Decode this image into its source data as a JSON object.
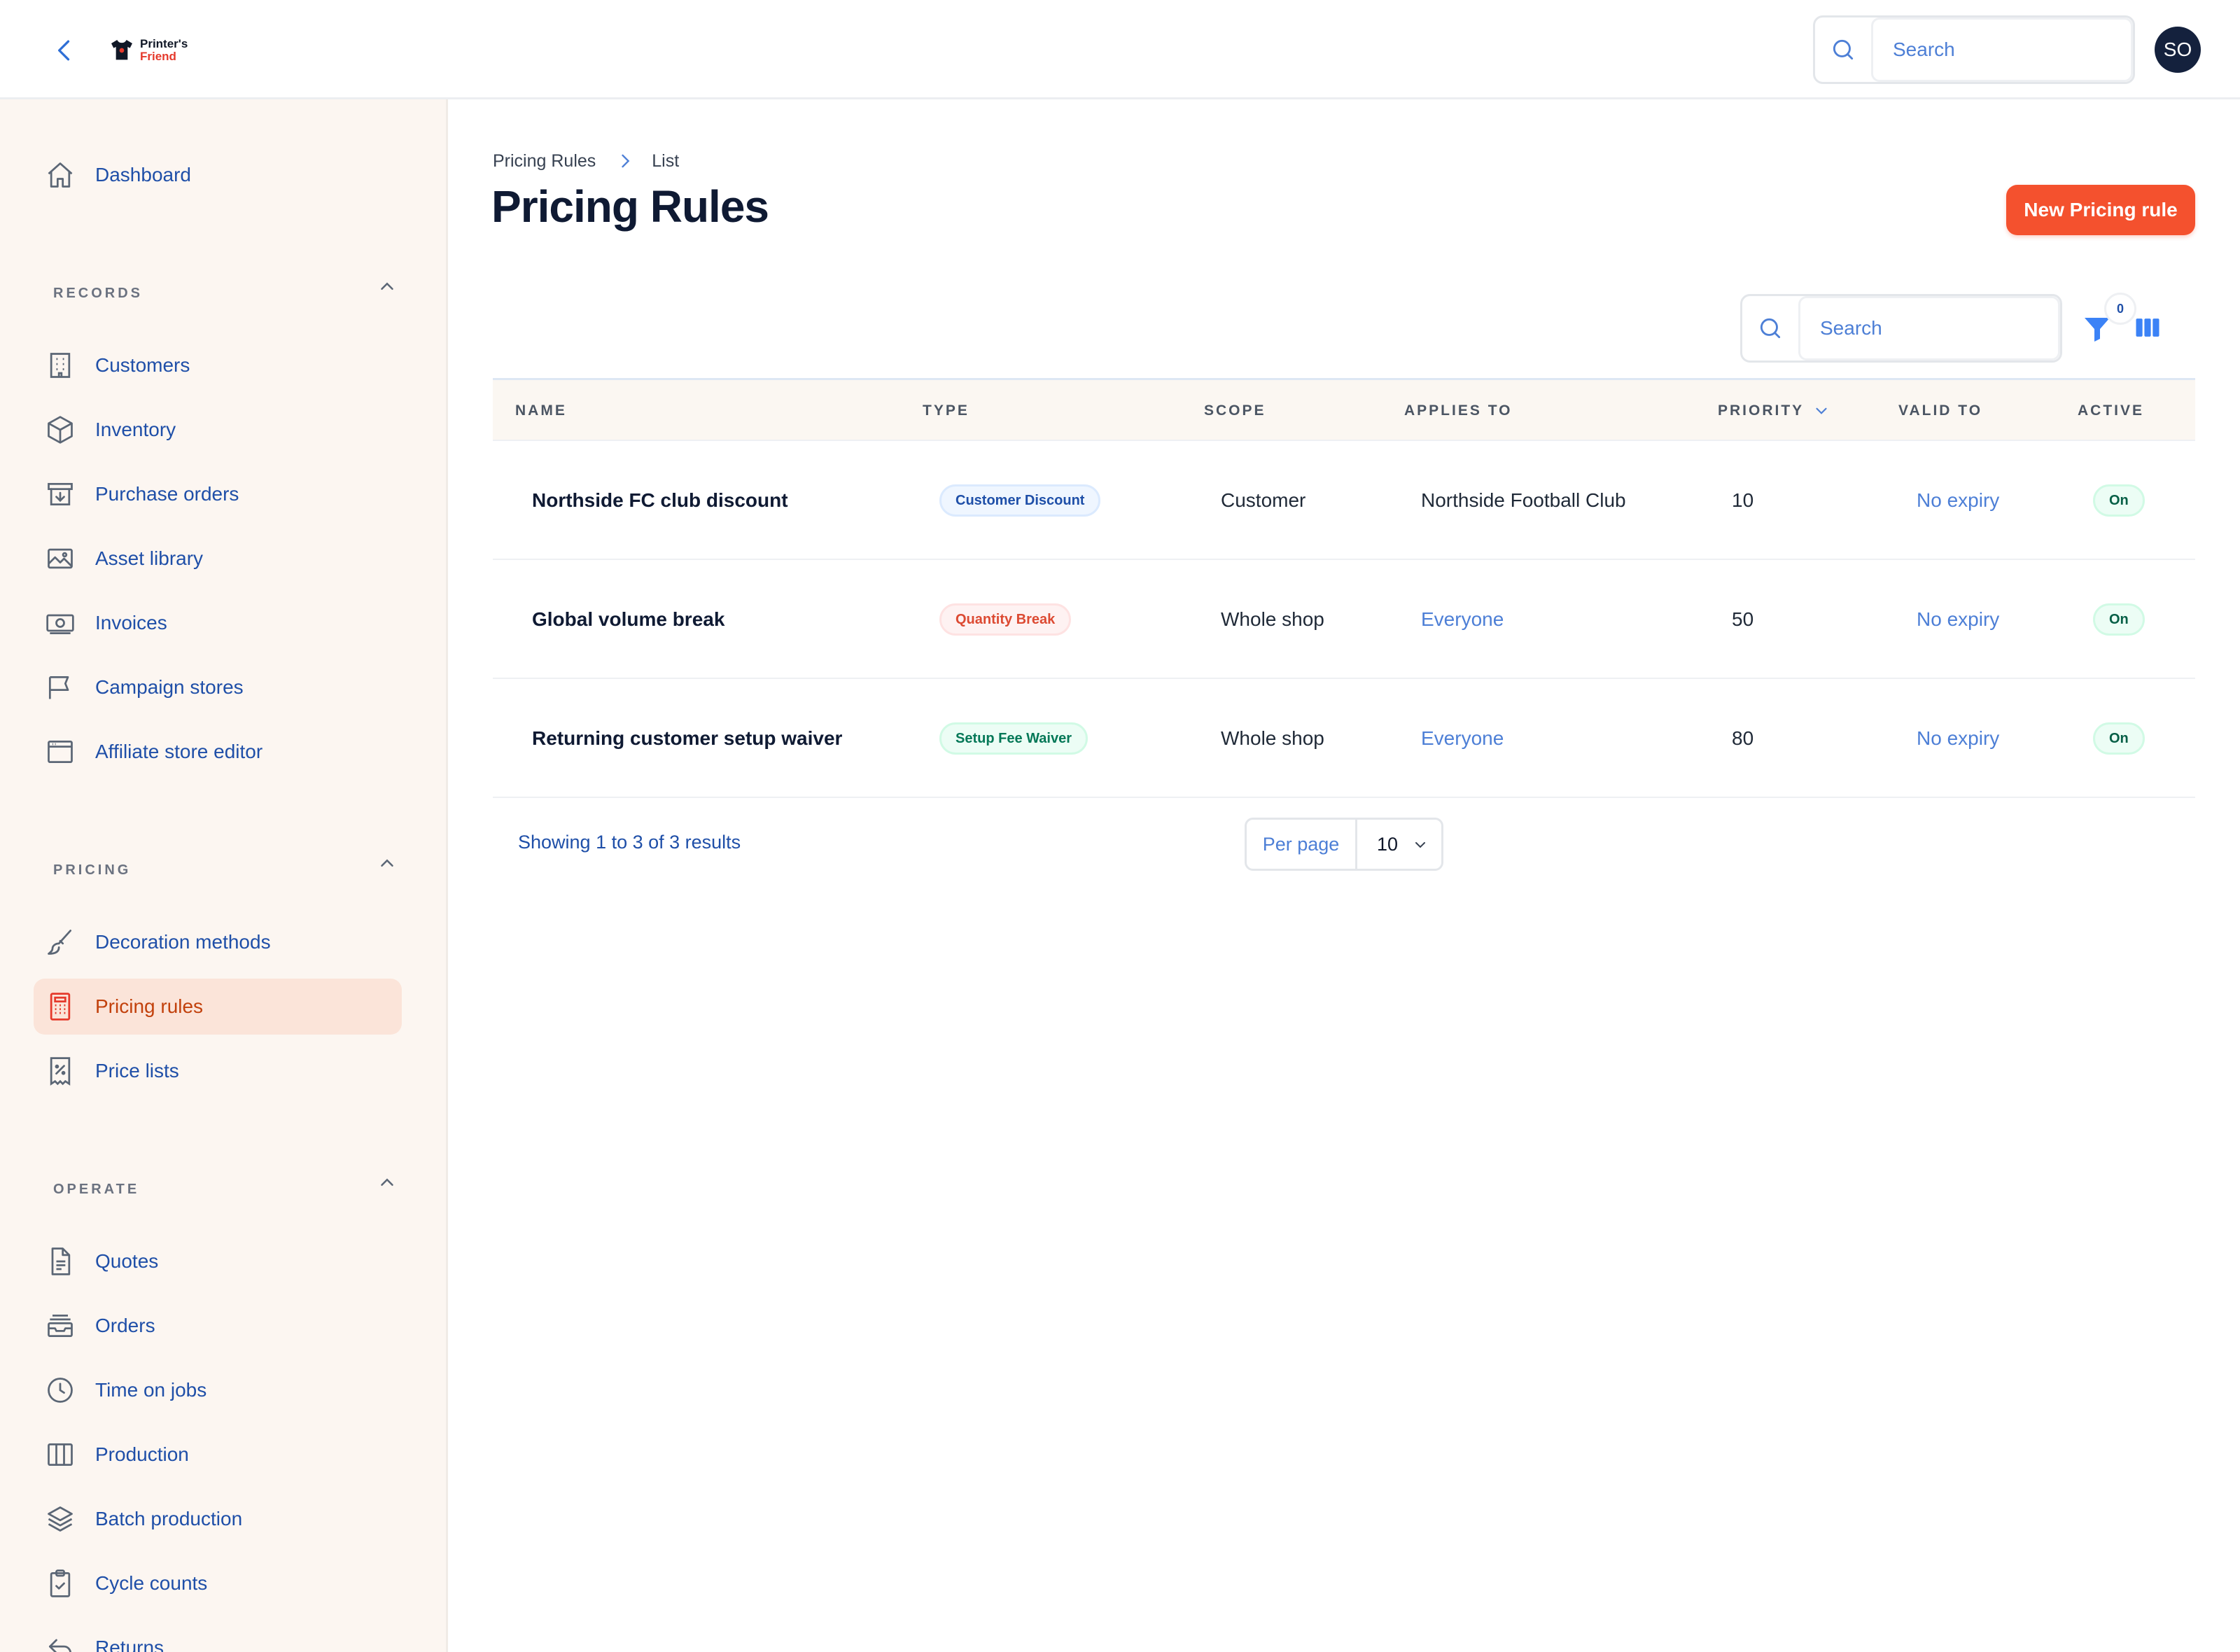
{
  "app": {
    "logo_line1": "Printer's",
    "logo_line2": "Friend",
    "search_placeholder": "Search",
    "avatar_initials": "SO"
  },
  "sidebar": {
    "dashboard": {
      "label": "Dashboard",
      "icon": "home-icon"
    },
    "sections": [
      {
        "title": "RECORDS",
        "items": [
          {
            "label": "Customers",
            "icon": "building-icon"
          },
          {
            "label": "Inventory",
            "icon": "box-icon"
          },
          {
            "label": "Purchase orders",
            "icon": "archive-download-icon"
          },
          {
            "label": "Asset library",
            "icon": "image-icon"
          },
          {
            "label": "Invoices",
            "icon": "cash-icon"
          },
          {
            "label": "Campaign stores",
            "icon": "flag-icon"
          },
          {
            "label": "Affiliate store editor",
            "icon": "browser-window-icon"
          }
        ]
      },
      {
        "title": "PRICING",
        "items": [
          {
            "label": "Decoration methods",
            "icon": "paintbrush-icon"
          },
          {
            "label": "Pricing rules",
            "icon": "calculator-icon",
            "active": true
          },
          {
            "label": "Price lists",
            "icon": "receipt-percent-icon"
          }
        ]
      },
      {
        "title": "OPERATE",
        "items": [
          {
            "label": "Quotes",
            "icon": "document-icon"
          },
          {
            "label": "Orders",
            "icon": "inbox-stack-icon"
          },
          {
            "label": "Time on jobs",
            "icon": "clock-icon"
          },
          {
            "label": "Production",
            "icon": "view-columns-icon"
          },
          {
            "label": "Batch production",
            "icon": "layers-icon"
          },
          {
            "label": "Cycle counts",
            "icon": "clipboard-check-icon"
          },
          {
            "label": "Returns",
            "icon": "return-arrow-icon"
          }
        ]
      }
    ]
  },
  "breadcrumb": {
    "parent": "Pricing Rules",
    "current": "List"
  },
  "page": {
    "title": "Pricing Rules",
    "new_button": "New Pricing rule",
    "search_placeholder": "Search",
    "filter_count": "0"
  },
  "table": {
    "columns": {
      "name": "NAME",
      "type": "TYPE",
      "scope": "SCOPE",
      "applies_to": "APPLIES TO",
      "priority": "PRIORITY",
      "valid_to": "VALID TO",
      "active": "ACTIVE"
    },
    "rows": [
      {
        "name": "Northside FC club discount",
        "type": "Customer Discount",
        "type_variant": "blue",
        "scope": "Customer",
        "applies_to": "Northside Football Club",
        "applies_muted": false,
        "priority": "10",
        "valid_to": "No expiry",
        "active": "On"
      },
      {
        "name": "Global volume break",
        "type": "Quantity Break",
        "type_variant": "red",
        "scope": "Whole shop",
        "applies_to": "Everyone",
        "applies_muted": true,
        "priority": "50",
        "valid_to": "No expiry",
        "active": "On"
      },
      {
        "name": "Returning customer setup waiver",
        "type": "Setup Fee Waiver",
        "type_variant": "green",
        "scope": "Whole shop",
        "applies_to": "Everyone",
        "applies_muted": true,
        "priority": "80",
        "valid_to": "No expiry",
        "active": "On"
      }
    ]
  },
  "pagination": {
    "results_text": "Showing 1 to 3 of 3 results",
    "per_page_label": "Per page",
    "per_page_value": "10"
  },
  "colors": {
    "accent": "#f4512e",
    "link_blue": "#1f4fa8",
    "muted_blue": "#4d7fd6",
    "sidebar_bg": "#fcf6f1",
    "active_bg": "#fbe4d9"
  }
}
